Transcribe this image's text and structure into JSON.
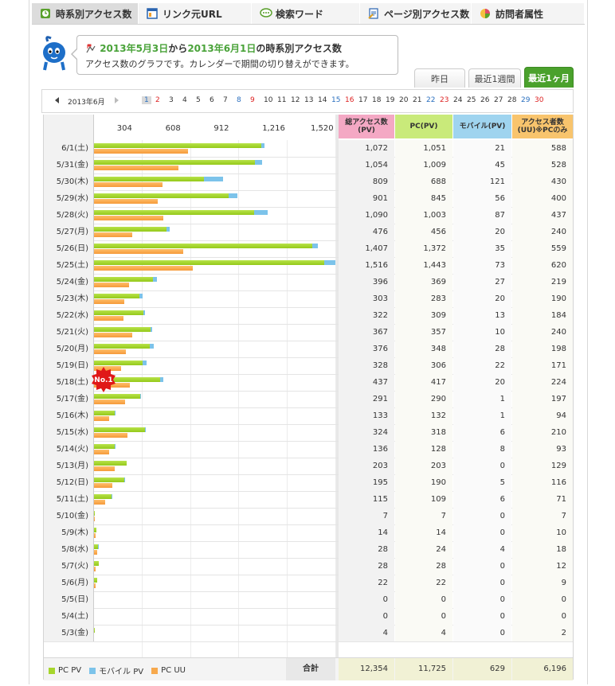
{
  "tabs": [
    {
      "label": "時系別アクセス数",
      "icon": "clock-icon",
      "active": true
    },
    {
      "label": "リンク元URL",
      "icon": "window-icon",
      "active": false
    },
    {
      "label": "検索ワード",
      "icon": "speech-bubble-icon",
      "active": false
    },
    {
      "label": "ページ別アクセス数",
      "icon": "page-icon",
      "active": false
    },
    {
      "label": "訪問者属性",
      "icon": "pie-chart-icon",
      "active": false
    }
  ],
  "bubble": {
    "start_date": "2013年5月3日",
    "from": "から",
    "end_date": "2013年6月1日",
    "suffix": "の時系別アクセス数",
    "line2": "アクセス数のグラフです。カレンダーで期間の切り替えができます。"
  },
  "range_tabs": [
    "昨日",
    "最近1週間",
    "最近1ヶ月"
  ],
  "calendar": {
    "month": "2013年6月",
    "days": [
      "1",
      "2",
      "3",
      "4",
      "5",
      "6",
      "7",
      "8",
      "9",
      "10",
      "11",
      "12",
      "13",
      "14",
      "15",
      "16",
      "17",
      "18",
      "19",
      "20",
      "21",
      "22",
      "23",
      "24",
      "25",
      "26",
      "27",
      "28",
      "29",
      "30"
    ]
  },
  "headers": {
    "scale": [
      "304",
      "608",
      "912",
      "1,216",
      "1,520"
    ],
    "total_pv": "総アクセス数 (PV)",
    "pc_pv": "PC(PV)",
    "mobile_pv": "モバイル(PV)",
    "uu": "アクセス者数 (UU)※PCのみ"
  },
  "badge": "No.1",
  "rows": [
    {
      "date": "6/1(土)",
      "total": "1,072",
      "pc": "1,051",
      "mobile": "21",
      "uu": "588"
    },
    {
      "date": "5/31(金)",
      "total": "1,054",
      "pc": "1,009",
      "mobile": "45",
      "uu": "528"
    },
    {
      "date": "5/30(木)",
      "total": "809",
      "pc": "688",
      "mobile": "121",
      "uu": "430"
    },
    {
      "date": "5/29(水)",
      "total": "901",
      "pc": "845",
      "mobile": "56",
      "uu": "400"
    },
    {
      "date": "5/28(火)",
      "total": "1,090",
      "pc": "1,003",
      "mobile": "87",
      "uu": "437"
    },
    {
      "date": "5/27(月)",
      "total": "476",
      "pc": "456",
      "mobile": "20",
      "uu": "240"
    },
    {
      "date": "5/26(日)",
      "total": "1,407",
      "pc": "1,372",
      "mobile": "35",
      "uu": "559"
    },
    {
      "date": "5/25(土)",
      "total": "1,516",
      "pc": "1,443",
      "mobile": "73",
      "uu": "620"
    },
    {
      "date": "5/24(金)",
      "total": "396",
      "pc": "369",
      "mobile": "27",
      "uu": "219"
    },
    {
      "date": "5/23(木)",
      "total": "303",
      "pc": "283",
      "mobile": "20",
      "uu": "190"
    },
    {
      "date": "5/22(水)",
      "total": "322",
      "pc": "309",
      "mobile": "13",
      "uu": "184"
    },
    {
      "date": "5/21(火)",
      "total": "367",
      "pc": "357",
      "mobile": "10",
      "uu": "240"
    },
    {
      "date": "5/20(月)",
      "total": "376",
      "pc": "348",
      "mobile": "28",
      "uu": "198"
    },
    {
      "date": "5/19(日)",
      "total": "328",
      "pc": "306",
      "mobile": "22",
      "uu": "171"
    },
    {
      "date": "5/18(土)",
      "total": "437",
      "pc": "417",
      "mobile": "20",
      "uu": "224"
    },
    {
      "date": "5/17(金)",
      "total": "291",
      "pc": "290",
      "mobile": "1",
      "uu": "197"
    },
    {
      "date": "5/16(木)",
      "total": "133",
      "pc": "132",
      "mobile": "1",
      "uu": "94"
    },
    {
      "date": "5/15(水)",
      "total": "324",
      "pc": "318",
      "mobile": "6",
      "uu": "210"
    },
    {
      "date": "5/14(火)",
      "total": "136",
      "pc": "128",
      "mobile": "8",
      "uu": "93"
    },
    {
      "date": "5/13(月)",
      "total": "203",
      "pc": "203",
      "mobile": "0",
      "uu": "129"
    },
    {
      "date": "5/12(日)",
      "total": "195",
      "pc": "190",
      "mobile": "5",
      "uu": "116"
    },
    {
      "date": "5/11(土)",
      "total": "115",
      "pc": "109",
      "mobile": "6",
      "uu": "71"
    },
    {
      "date": "5/10(金)",
      "total": "7",
      "pc": "7",
      "mobile": "0",
      "uu": "7"
    },
    {
      "date": "5/9(木)",
      "total": "14",
      "pc": "14",
      "mobile": "0",
      "uu": "10"
    },
    {
      "date": "5/8(水)",
      "total": "28",
      "pc": "24",
      "mobile": "4",
      "uu": "18"
    },
    {
      "date": "5/7(火)",
      "total": "28",
      "pc": "28",
      "mobile": "0",
      "uu": "12"
    },
    {
      "date": "5/6(月)",
      "total": "22",
      "pc": "22",
      "mobile": "0",
      "uu": "9"
    },
    {
      "date": "5/5(日)",
      "total": "0",
      "pc": "0",
      "mobile": "0",
      "uu": "0"
    },
    {
      "date": "5/4(土)",
      "total": "0",
      "pc": "0",
      "mobile": "0",
      "uu": "0"
    },
    {
      "date": "5/3(金)",
      "total": "4",
      "pc": "4",
      "mobile": "0",
      "uu": "2"
    }
  ],
  "legend": [
    "PC PV",
    "モバイル PV",
    "PC UU"
  ],
  "footer": {
    "label": "合計",
    "total": "12,354",
    "pc": "11,725",
    "mobile": "629",
    "uu": "6,196"
  },
  "colors": {
    "pc": "#a6d62c",
    "mobile": "#7cc3ea",
    "uu": "#f7a94d",
    "accent": "#4aa12c"
  },
  "chart_data": {
    "type": "bar",
    "xlim": [
      0,
      1520
    ],
    "categories": [
      "6/1(土)",
      "5/31(金)",
      "5/30(木)",
      "5/29(水)",
      "5/28(火)",
      "5/27(月)",
      "5/26(日)",
      "5/25(土)",
      "5/24(金)",
      "5/23(木)",
      "5/22(水)",
      "5/21(火)",
      "5/20(月)",
      "5/19(日)",
      "5/18(土)",
      "5/17(金)",
      "5/16(木)",
      "5/15(水)",
      "5/14(火)",
      "5/13(月)",
      "5/12(日)",
      "5/11(土)",
      "5/10(金)",
      "5/9(木)",
      "5/8(水)",
      "5/7(火)",
      "5/6(月)",
      "5/5(日)",
      "5/4(土)",
      "5/3(金)"
    ],
    "series": [
      {
        "name": "PC PV",
        "values": [
          1051,
          1009,
          688,
          845,
          1003,
          456,
          1372,
          1443,
          369,
          283,
          309,
          357,
          348,
          306,
          417,
          290,
          132,
          318,
          128,
          203,
          190,
          109,
          7,
          14,
          24,
          28,
          22,
          0,
          0,
          4
        ]
      },
      {
        "name": "モバイル PV",
        "values": [
          21,
          45,
          121,
          56,
          87,
          20,
          35,
          73,
          27,
          20,
          13,
          10,
          28,
          22,
          20,
          1,
          1,
          6,
          8,
          0,
          5,
          6,
          0,
          0,
          4,
          0,
          0,
          0,
          0,
          0
        ]
      },
      {
        "name": "PC UU",
        "values": [
          588,
          528,
          430,
          400,
          437,
          240,
          559,
          620,
          219,
          190,
          184,
          240,
          198,
          171,
          224,
          197,
          94,
          210,
          93,
          129,
          116,
          71,
          7,
          10,
          18,
          12,
          9,
          0,
          0,
          2
        ]
      }
    ]
  }
}
